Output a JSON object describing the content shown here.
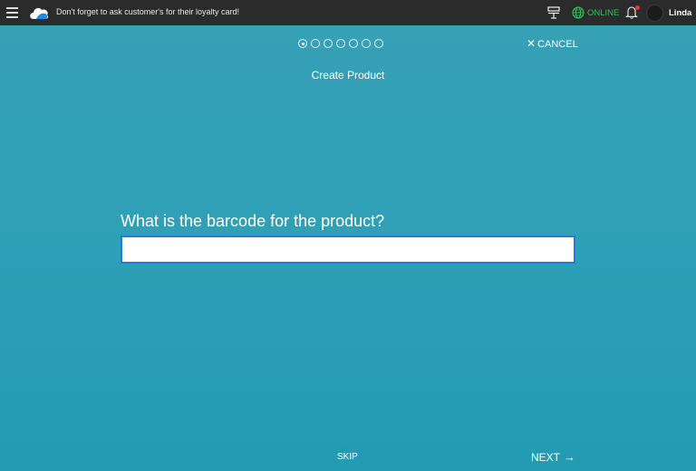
{
  "header": {
    "notice": "Don't forget to ask customer's for their loyalty card!",
    "status": "ONLINE",
    "user_name": "Linda",
    "status_color": "#2ec25a",
    "icons": [
      "menu-icon",
      "cloud-logo-icon",
      "register-icon",
      "globe-icon",
      "bell-icon"
    ]
  },
  "wizard": {
    "title": "Create Product",
    "total_steps": 7,
    "current_step": 1,
    "cancel_label": "CANCEL",
    "cancel_icon": "✕",
    "question": "What is the barcode for the product?",
    "barcode_value": "",
    "skip_label": "SKIP",
    "next_label": "NEXT",
    "next_icon": "→"
  }
}
